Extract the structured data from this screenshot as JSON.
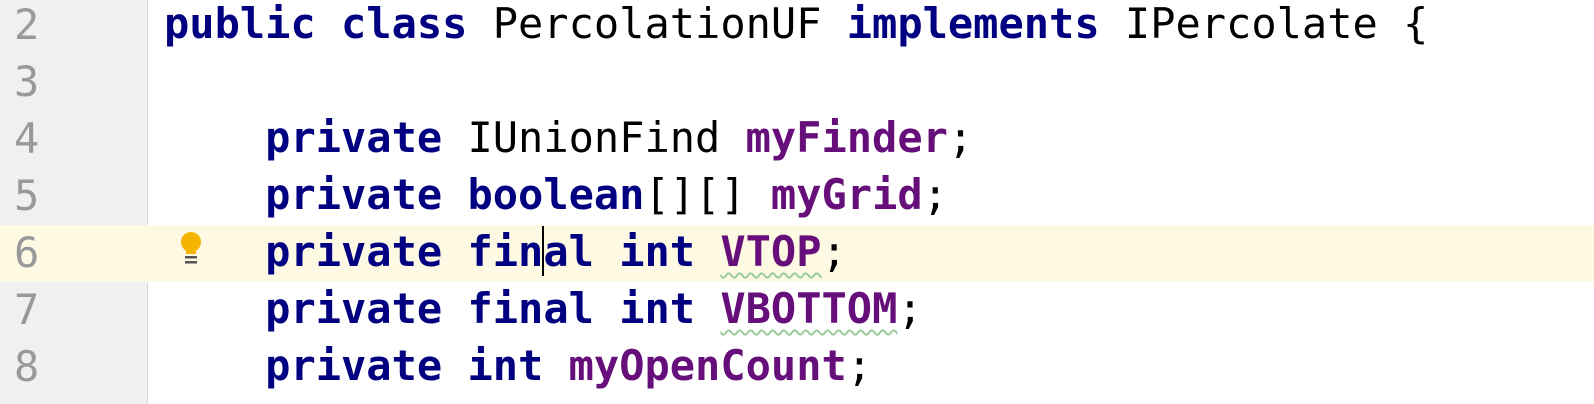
{
  "editor": {
    "language": "java",
    "colors": {
      "keyword": "#000080",
      "field": "#660e7a",
      "line_number": "#999999",
      "current_line_bg": "#fdf9e3",
      "gutter_bg": "#f0f0f0",
      "warning_underline": "#9ccc9c"
    },
    "intention_icon": "lightbulb-icon",
    "lines": [
      {
        "number": "2",
        "tokens": [
          {
            "text": "public",
            "kind": "kw"
          },
          {
            "text": " ",
            "kind": "plain"
          },
          {
            "text": "class",
            "kind": "kw"
          },
          {
            "text": " PercolationUF ",
            "kind": "plain"
          },
          {
            "text": "implements",
            "kind": "kw"
          },
          {
            "text": " IPercolate {",
            "kind": "plain"
          }
        ]
      },
      {
        "number": "3",
        "tokens": []
      },
      {
        "number": "4",
        "tokens": [
          {
            "text": "    ",
            "kind": "plain"
          },
          {
            "text": "private",
            "kind": "kw"
          },
          {
            "text": " IUnionFind ",
            "kind": "plain"
          },
          {
            "text": "myFinder",
            "kind": "field"
          },
          {
            "text": ";",
            "kind": "plain"
          }
        ]
      },
      {
        "number": "5",
        "tokens": [
          {
            "text": "    ",
            "kind": "plain"
          },
          {
            "text": "private",
            "kind": "kw"
          },
          {
            "text": " ",
            "kind": "plain"
          },
          {
            "text": "boolean",
            "kind": "kw"
          },
          {
            "text": "[][] ",
            "kind": "plain"
          },
          {
            "text": "myGrid",
            "kind": "field"
          },
          {
            "text": ";",
            "kind": "plain"
          }
        ]
      },
      {
        "number": "6",
        "current": true,
        "tokens": [
          {
            "text": "    ",
            "kind": "plain"
          },
          {
            "text": "private",
            "kind": "kw"
          },
          {
            "text": " ",
            "kind": "plain"
          },
          {
            "text": "fin",
            "kind": "kw"
          },
          {
            "caret": true
          },
          {
            "text": "al",
            "kind": "kw"
          },
          {
            "text": " ",
            "kind": "plain"
          },
          {
            "text": "int",
            "kind": "kw"
          },
          {
            "text": " ",
            "kind": "plain"
          },
          {
            "text": "VTOP",
            "kind": "field",
            "warning": true
          },
          {
            "text": ";",
            "kind": "plain"
          }
        ]
      },
      {
        "number": "7",
        "tokens": [
          {
            "text": "    ",
            "kind": "plain"
          },
          {
            "text": "private",
            "kind": "kw"
          },
          {
            "text": " ",
            "kind": "plain"
          },
          {
            "text": "final",
            "kind": "kw"
          },
          {
            "text": " ",
            "kind": "plain"
          },
          {
            "text": "int",
            "kind": "kw"
          },
          {
            "text": " ",
            "kind": "plain"
          },
          {
            "text": "VBOTTOM",
            "kind": "field",
            "warning": true
          },
          {
            "text": ";",
            "kind": "plain"
          }
        ]
      },
      {
        "number": "8",
        "tokens": [
          {
            "text": "    ",
            "kind": "plain"
          },
          {
            "text": "private",
            "kind": "kw"
          },
          {
            "text": " ",
            "kind": "plain"
          },
          {
            "text": "int",
            "kind": "kw"
          },
          {
            "text": " ",
            "kind": "plain"
          },
          {
            "text": "myOpenCount",
            "kind": "field"
          },
          {
            "text": ";",
            "kind": "plain"
          }
        ]
      }
    ]
  }
}
